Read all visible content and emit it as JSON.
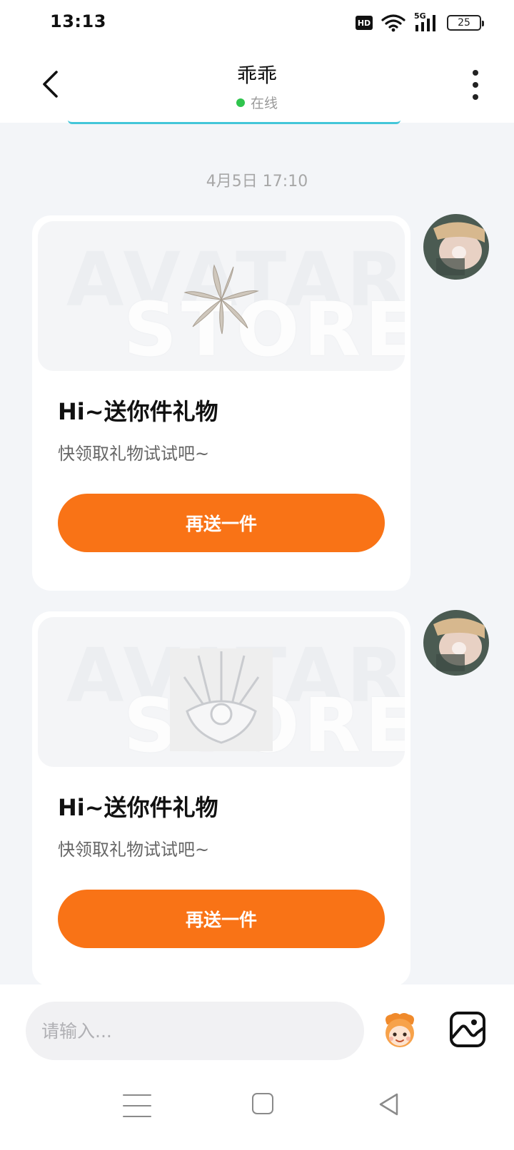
{
  "status": {
    "time": "13:13",
    "hd": "HD",
    "network": "5G",
    "battery": "25"
  },
  "header": {
    "title": "乖乖",
    "online_status": "在线"
  },
  "chat": {
    "timestamp": "4月5日 17:10",
    "messages": [
      {
        "watermark_top": "AVATAR",
        "watermark_bottom": "STORE",
        "title": "Hi~送你件礼物",
        "subtitle": "快领取礼物试试吧~",
        "button": "再送一件"
      },
      {
        "watermark_top": "AVATAR",
        "watermark_bottom": "STORE",
        "title": "Hi~送你件礼物",
        "subtitle": "快领取礼物试试吧~",
        "button": "再送一件"
      }
    ]
  },
  "input": {
    "placeholder": "请输入..."
  },
  "colors": {
    "accent": "#f97316",
    "online": "#2fc44d",
    "background": "#f3f5f8"
  },
  "icons": [
    "back-icon",
    "more-icon",
    "emoji-icon",
    "image-icon",
    "menu-icon",
    "home-icon",
    "back-nav-icon"
  ]
}
